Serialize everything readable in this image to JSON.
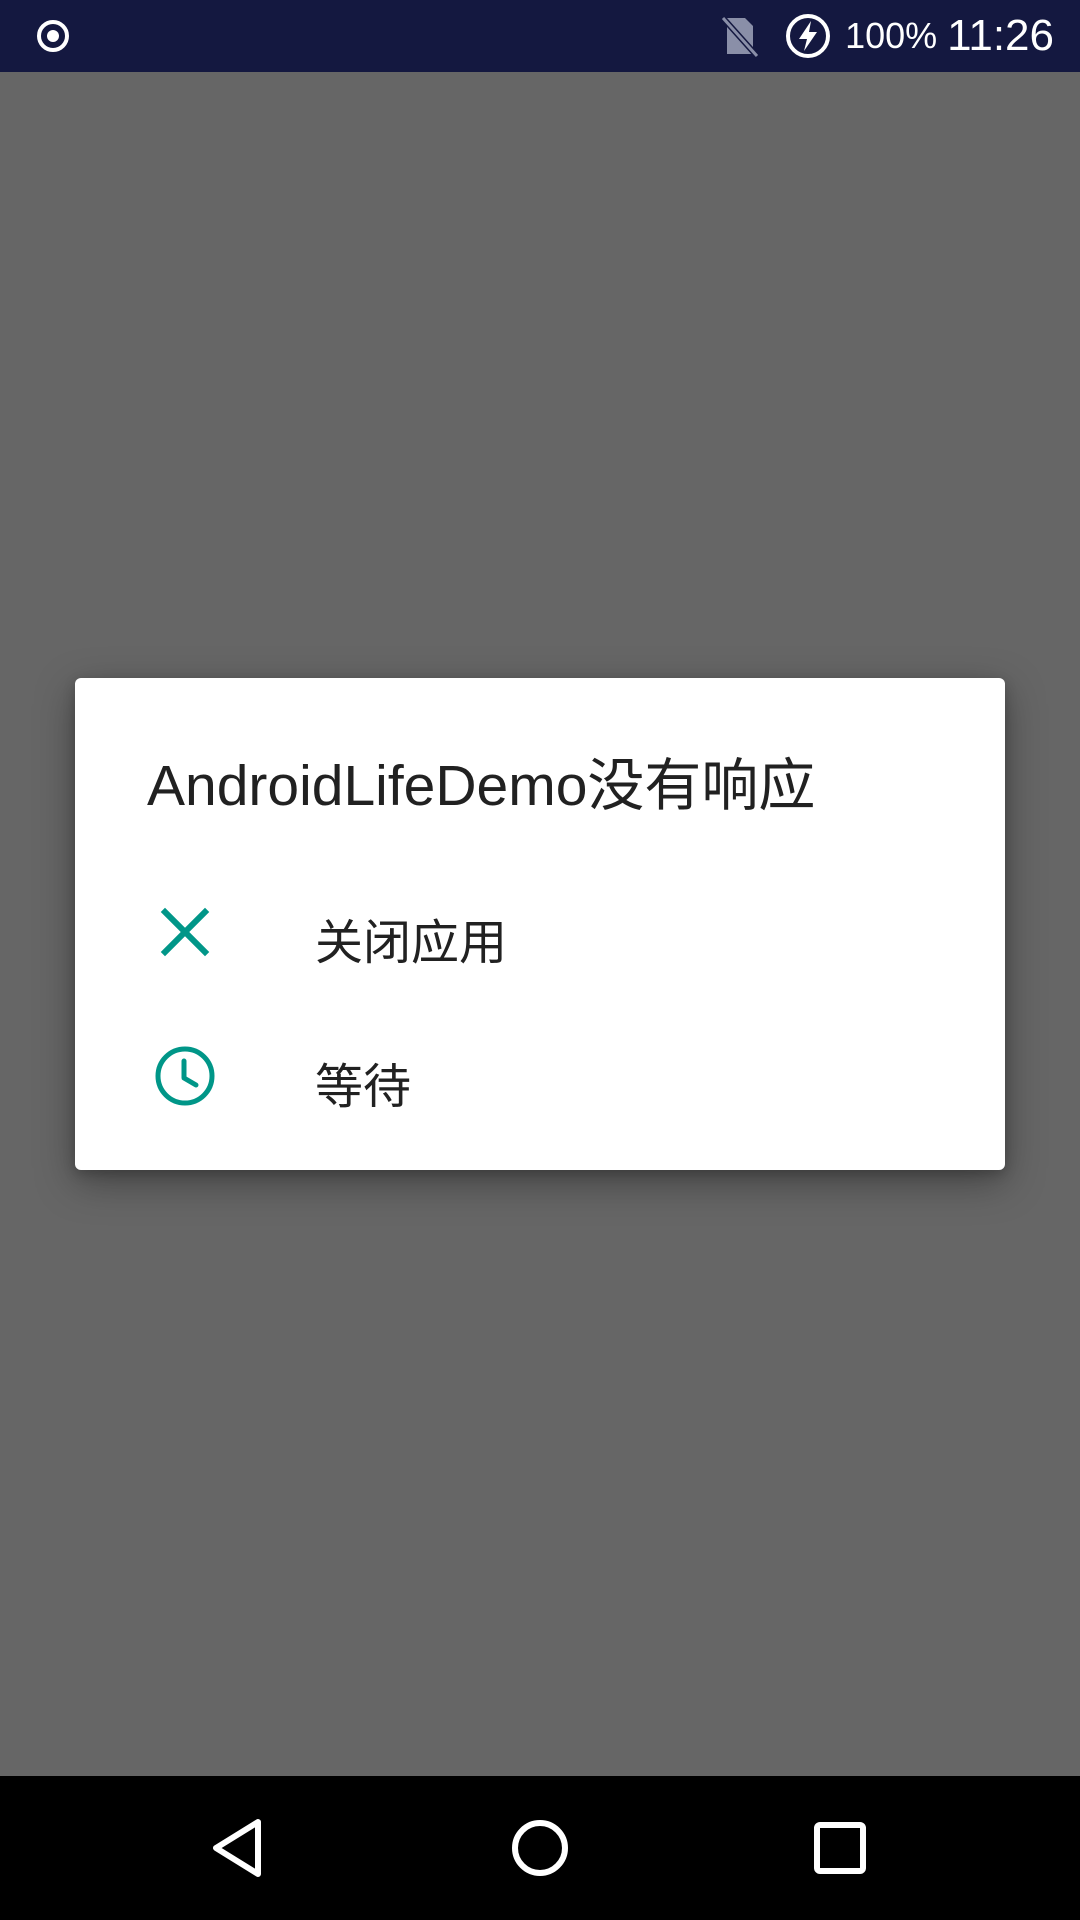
{
  "status_bar": {
    "left_icon": "radio-record-icon",
    "sim_icon": "no-sim-icon",
    "charging_icon": "battery-charging-icon",
    "battery_percent": "100%",
    "time": "11:26",
    "background_color": "#141840"
  },
  "dialog": {
    "title": "AndroidLifeDemo没有响应",
    "accent_color": "#009688",
    "options": [
      {
        "icon": "close-icon",
        "label": "关闭应用"
      },
      {
        "icon": "clock-icon",
        "label": "等待"
      }
    ]
  },
  "nav_bar": {
    "buttons": [
      "back-icon",
      "home-icon",
      "recents-icon"
    ]
  }
}
